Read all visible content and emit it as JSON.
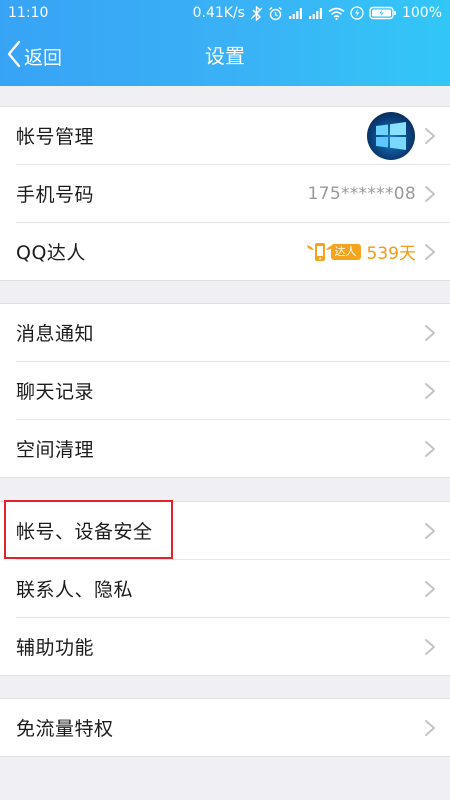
{
  "status_bar": {
    "time": "11:10",
    "network_speed": "0.41K/s",
    "battery": "100%"
  },
  "nav": {
    "back_label": "返回",
    "title": "设置"
  },
  "groups": [
    {
      "items": [
        {
          "label": "帐号管理",
          "right": "avatar"
        },
        {
          "label": "手机号码",
          "value": "175******08"
        },
        {
          "label": "QQ达人",
          "badge_tag": "达人",
          "badge_days": "539天"
        }
      ]
    },
    {
      "items": [
        {
          "label": "消息通知"
        },
        {
          "label": "聊天记录"
        },
        {
          "label": "空间清理"
        }
      ]
    },
    {
      "items": [
        {
          "label": "帐号、设备安全",
          "highlighted": true
        },
        {
          "label": "联系人、隐私"
        },
        {
          "label": "辅助功能"
        }
      ]
    },
    {
      "items": [
        {
          "label": "免流量特权"
        }
      ]
    }
  ],
  "colors": {
    "header_gradient_start": "#37a3f5",
    "header_gradient_end": "#32c7f7",
    "highlight_border": "#e0232d",
    "badge_orange": "#f39a12"
  }
}
